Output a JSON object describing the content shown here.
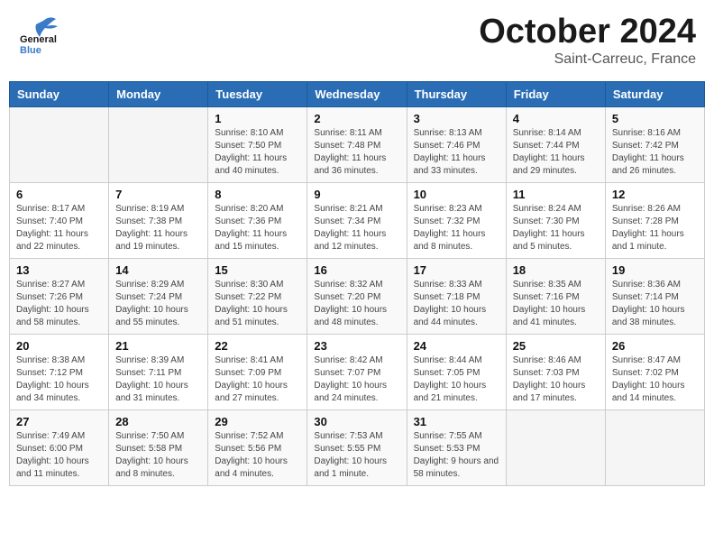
{
  "logo": {
    "text_general": "General",
    "text_blue": "Blue"
  },
  "title": "October 2024",
  "subtitle": "Saint-Carreuc, France",
  "days_of_week": [
    "Sunday",
    "Monday",
    "Tuesday",
    "Wednesday",
    "Thursday",
    "Friday",
    "Saturday"
  ],
  "weeks": [
    [
      {
        "day": "",
        "info": ""
      },
      {
        "day": "",
        "info": ""
      },
      {
        "day": "1",
        "info": "Sunrise: 8:10 AM\nSunset: 7:50 PM\nDaylight: 11 hours and 40 minutes."
      },
      {
        "day": "2",
        "info": "Sunrise: 8:11 AM\nSunset: 7:48 PM\nDaylight: 11 hours and 36 minutes."
      },
      {
        "day": "3",
        "info": "Sunrise: 8:13 AM\nSunset: 7:46 PM\nDaylight: 11 hours and 33 minutes."
      },
      {
        "day": "4",
        "info": "Sunrise: 8:14 AM\nSunset: 7:44 PM\nDaylight: 11 hours and 29 minutes."
      },
      {
        "day": "5",
        "info": "Sunrise: 8:16 AM\nSunset: 7:42 PM\nDaylight: 11 hours and 26 minutes."
      }
    ],
    [
      {
        "day": "6",
        "info": "Sunrise: 8:17 AM\nSunset: 7:40 PM\nDaylight: 11 hours and 22 minutes."
      },
      {
        "day": "7",
        "info": "Sunrise: 8:19 AM\nSunset: 7:38 PM\nDaylight: 11 hours and 19 minutes."
      },
      {
        "day": "8",
        "info": "Sunrise: 8:20 AM\nSunset: 7:36 PM\nDaylight: 11 hours and 15 minutes."
      },
      {
        "day": "9",
        "info": "Sunrise: 8:21 AM\nSunset: 7:34 PM\nDaylight: 11 hours and 12 minutes."
      },
      {
        "day": "10",
        "info": "Sunrise: 8:23 AM\nSunset: 7:32 PM\nDaylight: 11 hours and 8 minutes."
      },
      {
        "day": "11",
        "info": "Sunrise: 8:24 AM\nSunset: 7:30 PM\nDaylight: 11 hours and 5 minutes."
      },
      {
        "day": "12",
        "info": "Sunrise: 8:26 AM\nSunset: 7:28 PM\nDaylight: 11 hours and 1 minute."
      }
    ],
    [
      {
        "day": "13",
        "info": "Sunrise: 8:27 AM\nSunset: 7:26 PM\nDaylight: 10 hours and 58 minutes."
      },
      {
        "day": "14",
        "info": "Sunrise: 8:29 AM\nSunset: 7:24 PM\nDaylight: 10 hours and 55 minutes."
      },
      {
        "day": "15",
        "info": "Sunrise: 8:30 AM\nSunset: 7:22 PM\nDaylight: 10 hours and 51 minutes."
      },
      {
        "day": "16",
        "info": "Sunrise: 8:32 AM\nSunset: 7:20 PM\nDaylight: 10 hours and 48 minutes."
      },
      {
        "day": "17",
        "info": "Sunrise: 8:33 AM\nSunset: 7:18 PM\nDaylight: 10 hours and 44 minutes."
      },
      {
        "day": "18",
        "info": "Sunrise: 8:35 AM\nSunset: 7:16 PM\nDaylight: 10 hours and 41 minutes."
      },
      {
        "day": "19",
        "info": "Sunrise: 8:36 AM\nSunset: 7:14 PM\nDaylight: 10 hours and 38 minutes."
      }
    ],
    [
      {
        "day": "20",
        "info": "Sunrise: 8:38 AM\nSunset: 7:12 PM\nDaylight: 10 hours and 34 minutes."
      },
      {
        "day": "21",
        "info": "Sunrise: 8:39 AM\nSunset: 7:11 PM\nDaylight: 10 hours and 31 minutes."
      },
      {
        "day": "22",
        "info": "Sunrise: 8:41 AM\nSunset: 7:09 PM\nDaylight: 10 hours and 27 minutes."
      },
      {
        "day": "23",
        "info": "Sunrise: 8:42 AM\nSunset: 7:07 PM\nDaylight: 10 hours and 24 minutes."
      },
      {
        "day": "24",
        "info": "Sunrise: 8:44 AM\nSunset: 7:05 PM\nDaylight: 10 hours and 21 minutes."
      },
      {
        "day": "25",
        "info": "Sunrise: 8:46 AM\nSunset: 7:03 PM\nDaylight: 10 hours and 17 minutes."
      },
      {
        "day": "26",
        "info": "Sunrise: 8:47 AM\nSunset: 7:02 PM\nDaylight: 10 hours and 14 minutes."
      }
    ],
    [
      {
        "day": "27",
        "info": "Sunrise: 7:49 AM\nSunset: 6:00 PM\nDaylight: 10 hours and 11 minutes."
      },
      {
        "day": "28",
        "info": "Sunrise: 7:50 AM\nSunset: 5:58 PM\nDaylight: 10 hours and 8 minutes."
      },
      {
        "day": "29",
        "info": "Sunrise: 7:52 AM\nSunset: 5:56 PM\nDaylight: 10 hours and 4 minutes."
      },
      {
        "day": "30",
        "info": "Sunrise: 7:53 AM\nSunset: 5:55 PM\nDaylight: 10 hours and 1 minute."
      },
      {
        "day": "31",
        "info": "Sunrise: 7:55 AM\nSunset: 5:53 PM\nDaylight: 9 hours and 58 minutes."
      },
      {
        "day": "",
        "info": ""
      },
      {
        "day": "",
        "info": ""
      }
    ]
  ]
}
